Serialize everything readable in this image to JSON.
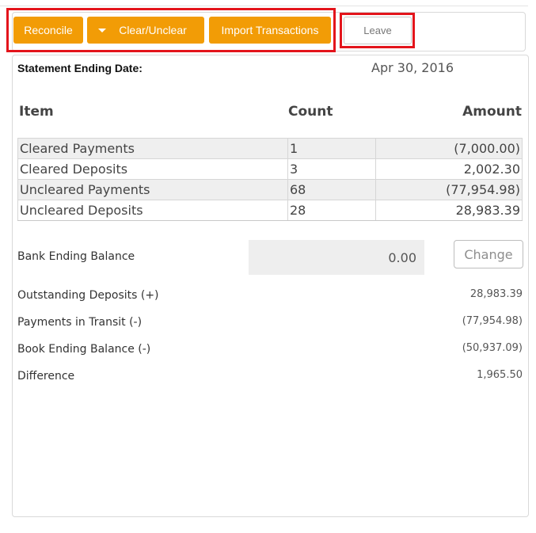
{
  "toolbar": {
    "reconcile_label": "Reconcile",
    "clear_unclear_label": "Clear/Unclear",
    "import_label": "Import Transactions",
    "leave_label": "Leave"
  },
  "statement": {
    "ending_date_label": "Statement Ending Date:",
    "ending_date_value": "Apr 30, 2016"
  },
  "items_table": {
    "headers": [
      "Item",
      "Count",
      "Amount"
    ],
    "rows": [
      {
        "item": "Cleared Payments",
        "count": "1",
        "amount": "(7,000.00)"
      },
      {
        "item": "Cleared Deposits",
        "count": "3",
        "amount": "2,002.30"
      },
      {
        "item": "Uncleared Payments",
        "count": "68",
        "amount": "(77,954.98)"
      },
      {
        "item": "Uncleared Deposits",
        "count": "28",
        "amount": "28,983.39"
      }
    ]
  },
  "summary": {
    "bank_ending_balance_label": "Bank Ending Balance",
    "bank_ending_balance_value": "0.00",
    "change_label": "Change",
    "outstanding_deposits_label": "Outstanding Deposits (+)",
    "outstanding_deposits_value": "28,983.39",
    "payments_in_transit_label": "Payments in Transit (-)",
    "payments_in_transit_value": "(77,954.98)",
    "book_ending_balance_label": "Book Ending Balance (-)",
    "book_ending_balance_value": "(50,937.09)",
    "difference_label": "Difference",
    "difference_value": "1,965.50"
  },
  "colors": {
    "accent": "#f29c06",
    "highlight": "#e3141b"
  }
}
